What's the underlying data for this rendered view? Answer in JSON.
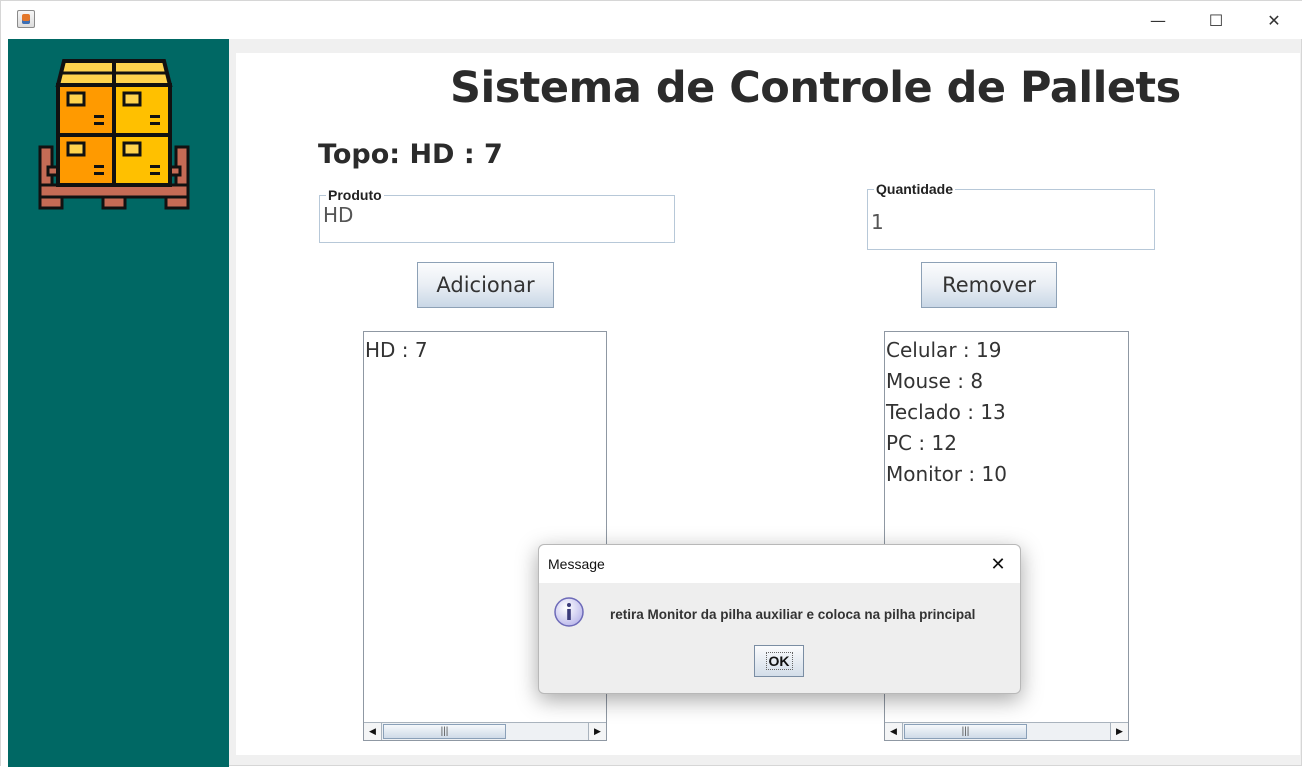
{
  "window": {
    "minimize_glyph": "—",
    "maximize_glyph": "☐",
    "close_glyph": "✕"
  },
  "colors": {
    "sidebar": "#006864",
    "text": "#2b2b2b"
  },
  "header": {
    "title": "Sistema de Controle de Pallets",
    "topo": "Topo: HD : 7"
  },
  "form": {
    "produto_label": "Produto",
    "produto_value": "HD",
    "quantidade_label": "Quantidade",
    "quantidade_value": "1",
    "add_label": "Adicionar",
    "remove_label": "Remover"
  },
  "lists": {
    "principal": [
      "HD : 7"
    ],
    "auxiliar": [
      "Celular : 19",
      "Mouse : 8",
      "Teclado : 13",
      "PC : 12",
      "Monitor : 10"
    ]
  },
  "dialog": {
    "title": "Message",
    "close_glyph": "✕",
    "message": "retira Monitor da pilha auxiliar e coloca na pilha principal",
    "ok_label": "OK"
  }
}
